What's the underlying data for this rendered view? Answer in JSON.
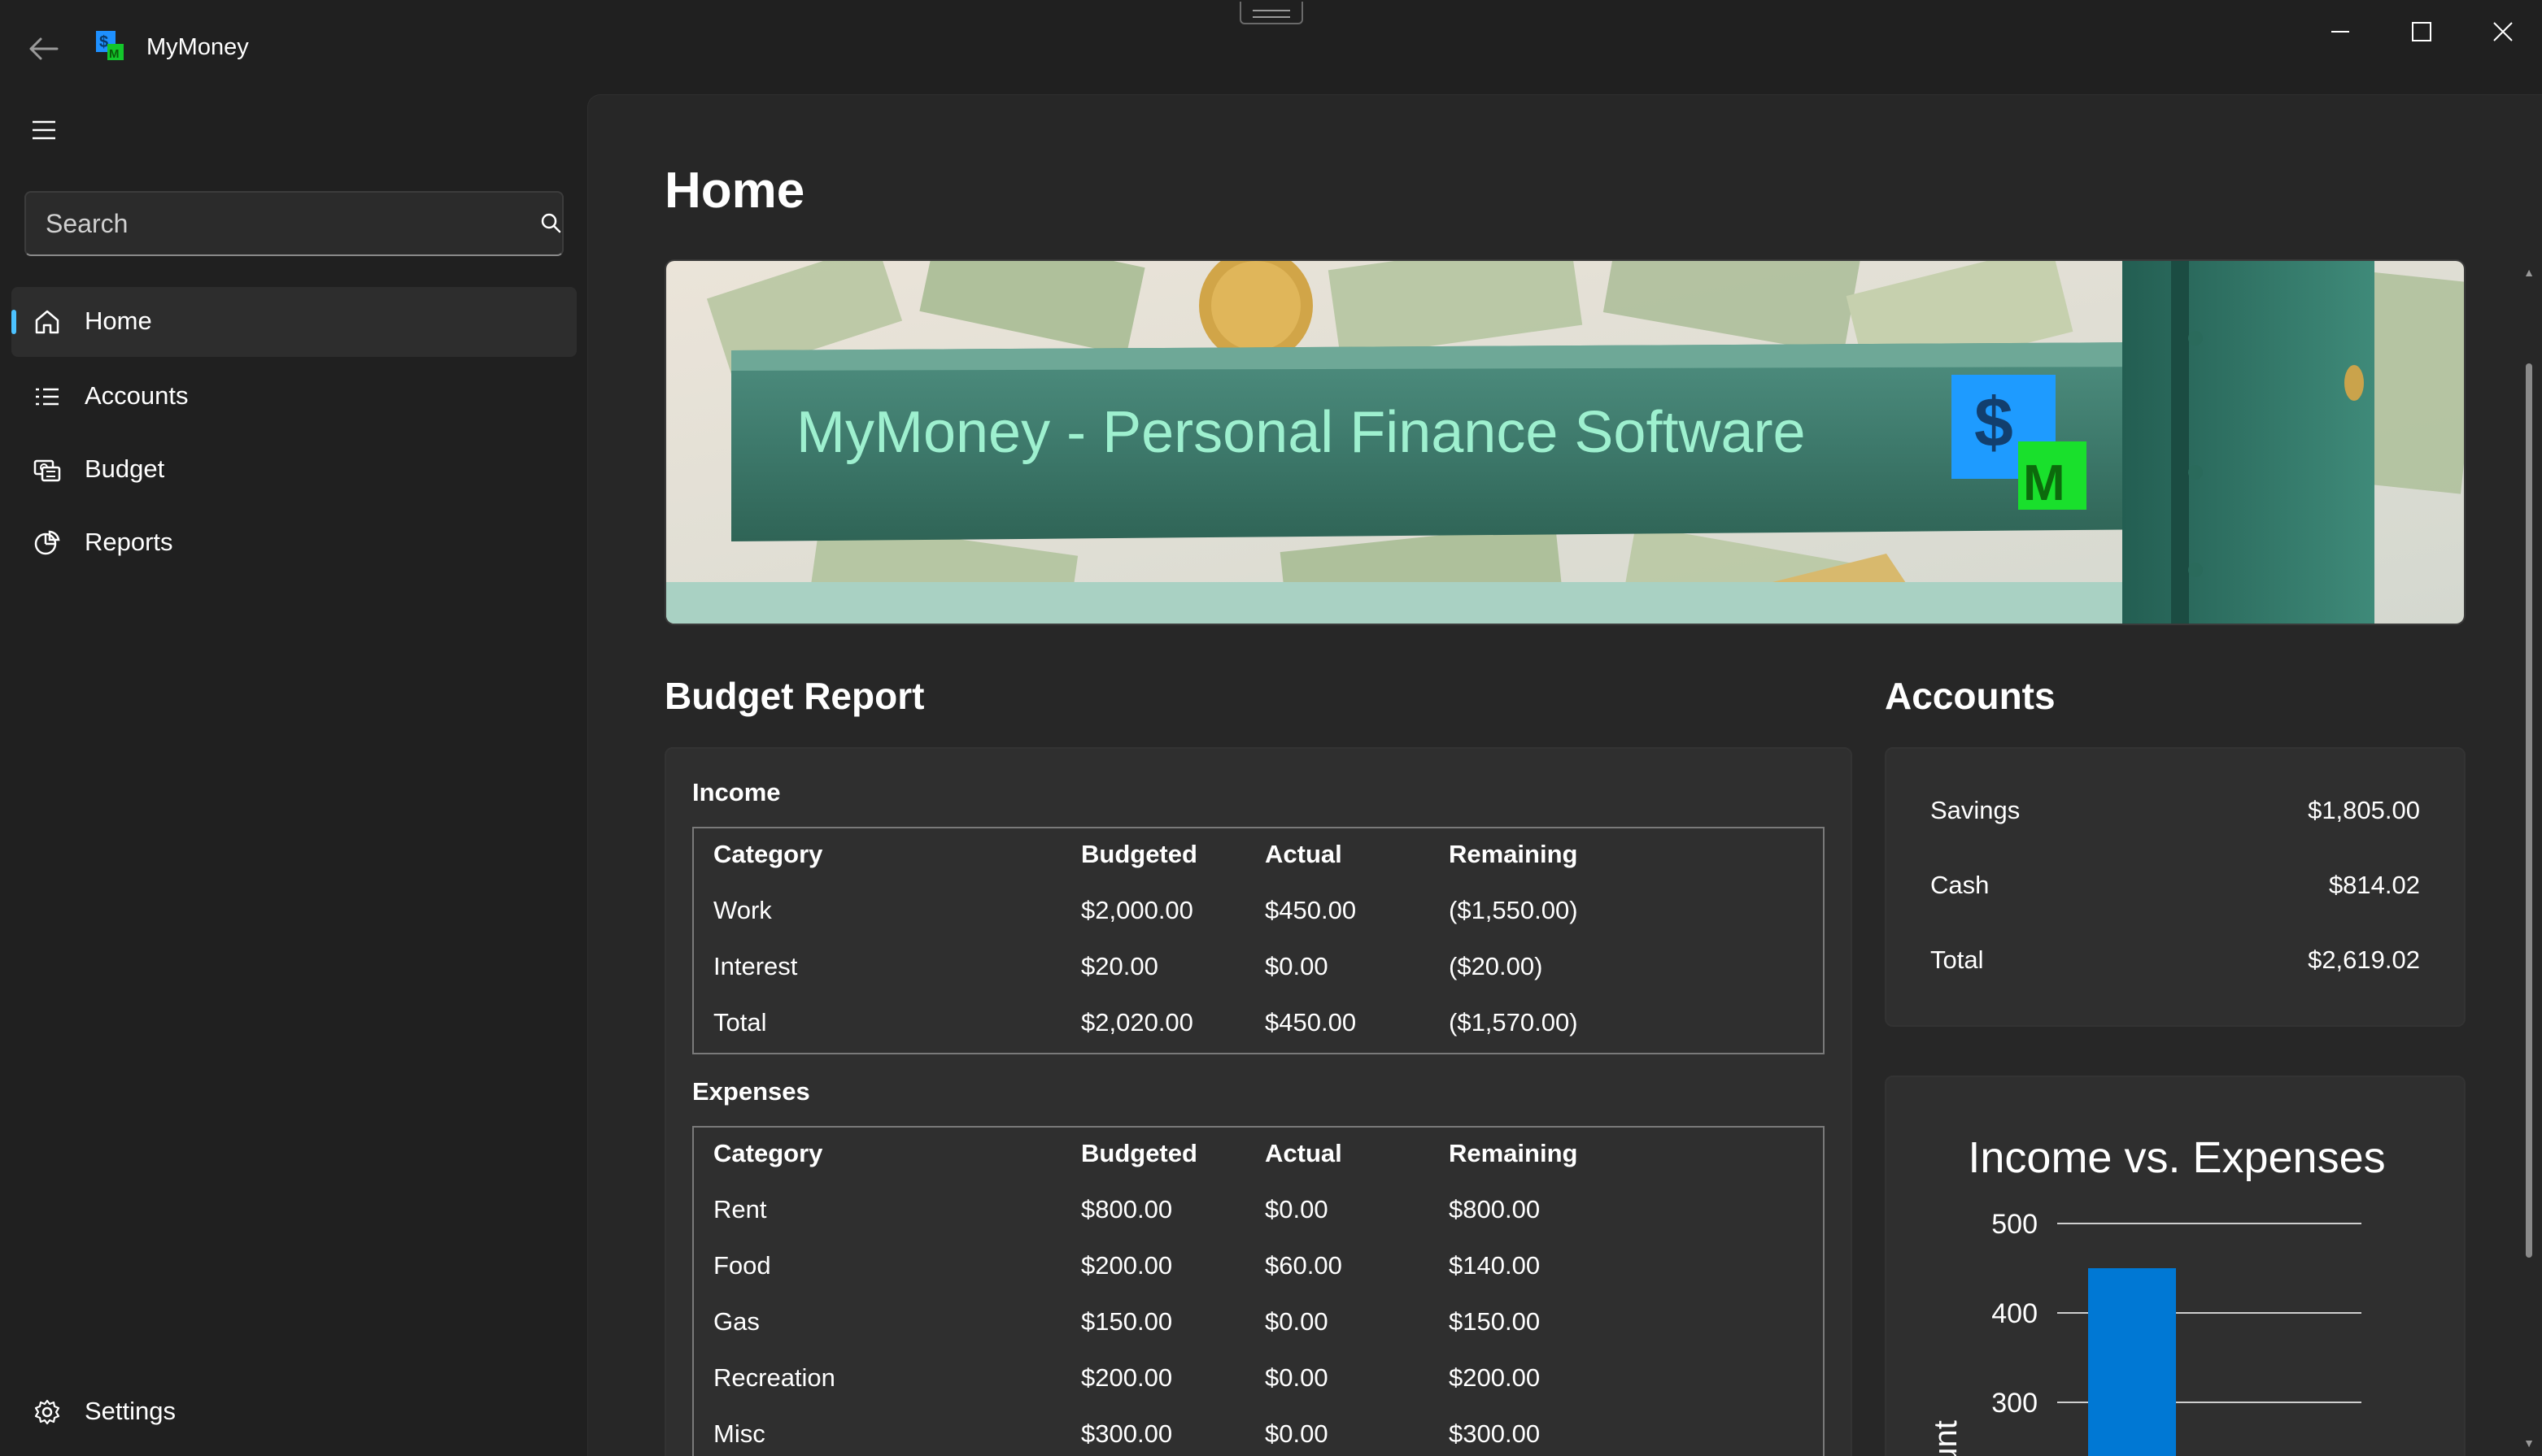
{
  "app": {
    "title": "MyMoney"
  },
  "search": {
    "placeholder": "Search"
  },
  "nav": {
    "items": [
      {
        "label": "Home",
        "icon": "home-icon",
        "active": true
      },
      {
        "label": "Accounts",
        "icon": "list-icon"
      },
      {
        "label": "Budget",
        "icon": "budget-icon"
      },
      {
        "label": "Reports",
        "icon": "reports-icon"
      }
    ],
    "settings": {
      "label": "Settings",
      "icon": "gear-icon"
    }
  },
  "page": {
    "title": "Home",
    "banner_title": "MyMoney - Personal Finance Software"
  },
  "budget": {
    "title": "Budget Report",
    "income": {
      "label": "Income",
      "headers": [
        "Category",
        "Budgeted",
        "Actual",
        "Remaining"
      ],
      "rows": [
        [
          "Work",
          "$2,000.00",
          "$450.00",
          "($1,550.00)"
        ],
        [
          "Interest",
          "$20.00",
          "$0.00",
          "($20.00)"
        ],
        [
          "Total",
          "$2,020.00",
          "$450.00",
          "($1,570.00)"
        ]
      ]
    },
    "expenses": {
      "label": "Expenses",
      "headers": [
        "Category",
        "Budgeted",
        "Actual",
        "Remaining"
      ],
      "rows": [
        [
          "Rent",
          "$800.00",
          "$0.00",
          "$800.00"
        ],
        [
          "Food",
          "$200.00",
          "$60.00",
          "$140.00"
        ],
        [
          "Gas",
          "$150.00",
          "$0.00",
          "$150.00"
        ],
        [
          "Recreation",
          "$200.00",
          "$0.00",
          "$200.00"
        ],
        [
          "Misc",
          "$300.00",
          "$0.00",
          "$300.00"
        ]
      ]
    }
  },
  "accounts": {
    "title": "Accounts",
    "rows": [
      {
        "name": "Savings",
        "value": "$1,805.00"
      },
      {
        "name": "Cash",
        "value": "$814.02"
      },
      {
        "name": "Total",
        "value": "$2,619.02"
      }
    ]
  },
  "chart_data": {
    "type": "bar",
    "title": "Income vs. Expenses",
    "ylabel": "ount",
    "yticks": [
      300,
      400,
      500
    ],
    "ylim": [
      0,
      500
    ],
    "values": [
      450
    ],
    "color": "#0078d4"
  },
  "colors": {
    "accent": "#4cc2ff",
    "bar": "#0078d4",
    "banner_text": "#9ef0cf"
  }
}
